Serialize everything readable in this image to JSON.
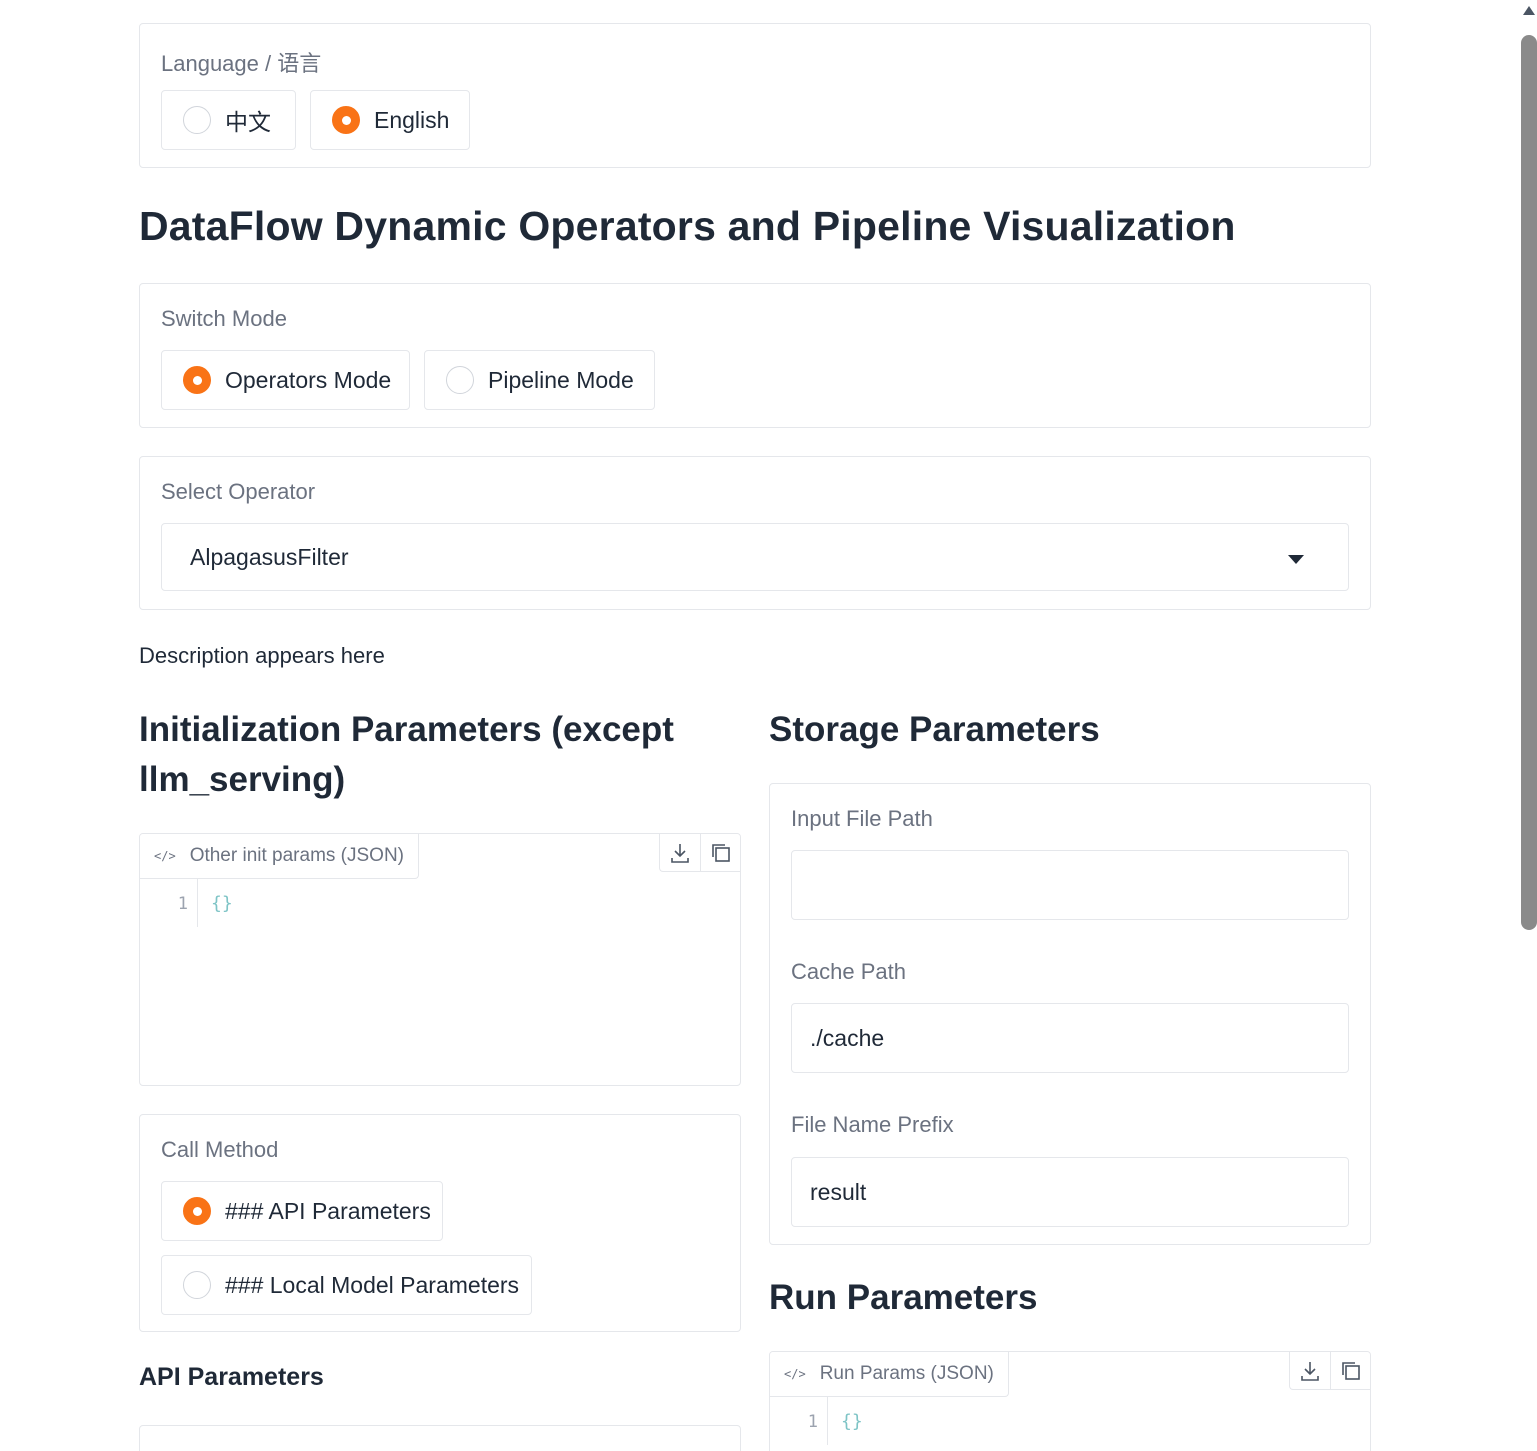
{
  "language": {
    "label": "Language / 语言",
    "options": [
      {
        "label": "中文",
        "selected": false
      },
      {
        "label": "English",
        "selected": true
      }
    ]
  },
  "page_title": "DataFlow Dynamic Operators and Pipeline Visualization",
  "switch_mode": {
    "label": "Switch Mode",
    "options": [
      {
        "label": "Operators Mode",
        "selected": true
      },
      {
        "label": "Pipeline Mode",
        "selected": false
      }
    ]
  },
  "select_operator": {
    "label": "Select Operator",
    "value": "AlpagasusFilter"
  },
  "description": "Description appears here",
  "init_params": {
    "heading": "Initialization Parameters (except llm_serving)",
    "editor_label": "Other init params (JSON)",
    "line_number": "1",
    "code": "{}"
  },
  "call_method": {
    "label": "Call Method",
    "options": [
      {
        "label": "### API Parameters",
        "selected": true
      },
      {
        "label": "### Local Model Parameters",
        "selected": false
      }
    ]
  },
  "api_params_heading": "API Parameters",
  "storage": {
    "heading": "Storage Parameters",
    "input_file_path": {
      "label": "Input File Path",
      "value": ""
    },
    "cache_path": {
      "label": "Cache Path",
      "value": "./cache"
    },
    "file_name_prefix": {
      "label": "File Name Prefix",
      "value": "result"
    }
  },
  "run_params": {
    "heading": "Run Parameters",
    "editor_label": "Run Params (JSON)",
    "line_number": "1",
    "code": "{}"
  },
  "colors": {
    "accent": "#f97316",
    "border": "#e5e7eb",
    "label": "#6b7280",
    "code": "#7ec4c6"
  }
}
